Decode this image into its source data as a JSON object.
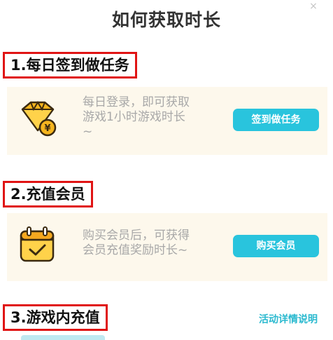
{
  "dialog": {
    "title": "如何获取时长",
    "close_icon": "close-icon"
  },
  "sections": [
    {
      "heading": "1.每日签到做任务",
      "icon": "diamond-coin-icon",
      "text_line1": "每日登录，即可获取",
      "text_line2": "游戏1小时游戏时长",
      "text_line3": "~",
      "button": "签到做任务"
    },
    {
      "heading": "2.充值会员",
      "icon": "calendar-check-icon",
      "text_line1": "购买会员后，可获得",
      "text_line2": "会员充值奖励时长~",
      "button": "购买会员"
    },
    {
      "heading": "3.游戏内充值"
    }
  ],
  "activity_link": "活动详情说明",
  "colors": {
    "accent": "#29c4dd",
    "highlight_border": "#e01414",
    "card_bg": "#fdf8ec"
  }
}
